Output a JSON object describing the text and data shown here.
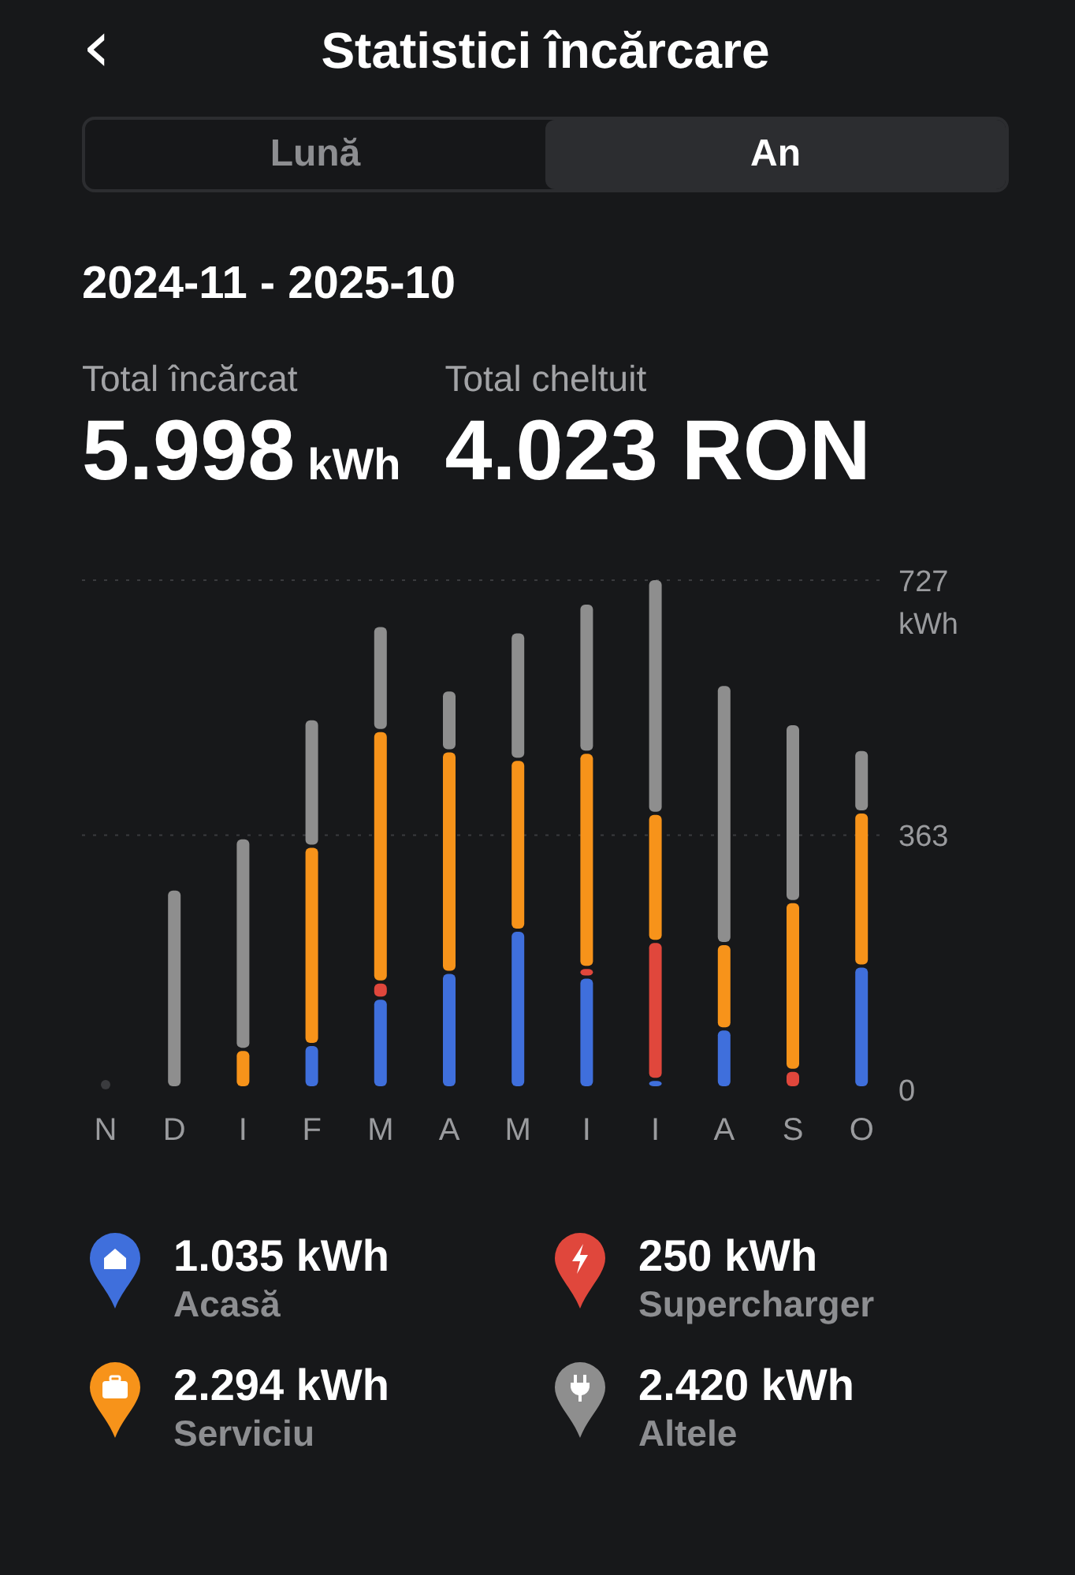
{
  "header": {
    "back": "‹",
    "title": "Statistici încărcare"
  },
  "tabs": [
    {
      "label": "Lună",
      "selected": false
    },
    {
      "label": "An",
      "selected": true
    }
  ],
  "period": "2024-11 - 2025-10",
  "totals": [
    {
      "label": "Total încărcat",
      "value": "5.998",
      "unit": "kWh"
    },
    {
      "label": "Total cheltuit",
      "value": "4.023 RON"
    }
  ],
  "chart_data": {
    "type": "bar",
    "stacked": true,
    "ylabel": "kWh",
    "categories": [
      "N",
      "D",
      "I",
      "F",
      "M",
      "A",
      "M",
      "I",
      "I",
      "A",
      "S",
      "O"
    ],
    "ylim": [
      0,
      727
    ],
    "yticks": [
      0,
      363,
      727
    ],
    "series": [
      {
        "name": "Acasă",
        "color": "#3f6fdc",
        "values": [
          0,
          0,
          0,
          62,
          128,
          165,
          225,
          158,
          12,
          84,
          0,
          174
        ]
      },
      {
        "name": "Supercharger",
        "color": "#e0473c",
        "values": [
          0,
          0,
          0,
          0,
          23,
          0,
          0,
          14,
          197,
          0,
          25,
          0
        ]
      },
      {
        "name": "Serviciu",
        "color": "#f7931a",
        "values": [
          0,
          0,
          55,
          283,
          359,
          316,
          244,
          307,
          183,
          122,
          241,
          220
        ]
      },
      {
        "name": "Altele",
        "color": "#8e8e8e",
        "values": [
          0,
          284,
          302,
          182,
          150,
          87,
          182,
          213,
          335,
          370,
          254,
          89
        ]
      }
    ]
  },
  "legend": [
    {
      "kind": "home",
      "value": "1.035 kWh"
    },
    {
      "kind": "bolt",
      "value": "250 kWh"
    },
    {
      "kind": "briefcase",
      "value": "2.294 kWh"
    },
    {
      "kind": "plug",
      "value": "2.420 kWh"
    }
  ]
}
